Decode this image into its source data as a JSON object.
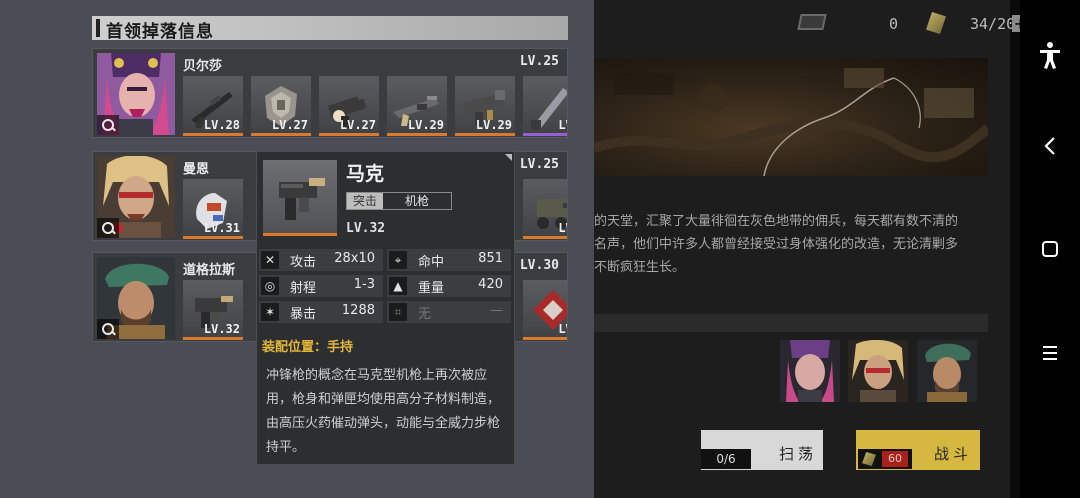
{
  "header": {
    "title": "首领掉落信息"
  },
  "bosses": [
    {
      "name": "贝尔莎",
      "level": "LV.25",
      "drops": [
        {
          "level": "LV.28",
          "icon": "sniper-rifle-icon",
          "rarity": "orange"
        },
        {
          "level": "LV.27",
          "icon": "armor-part-icon",
          "rarity": "orange"
        },
        {
          "level": "LV.27",
          "icon": "heavy-gun-icon",
          "rarity": "orange"
        },
        {
          "level": "LV.29",
          "icon": "rifle-icon",
          "rarity": "orange"
        },
        {
          "level": "LV.29",
          "icon": "launcher-icon",
          "rarity": "orange"
        },
        {
          "level": "LV.",
          "icon": "blade-icon",
          "rarity": "purple"
        }
      ]
    },
    {
      "name": "曼恩",
      "level": "LV.25",
      "drops": [
        {
          "level": "LV.31",
          "icon": "gauntlet-icon",
          "rarity": "orange"
        },
        {
          "level": "LV.",
          "icon": "turret-icon",
          "rarity": "orange"
        }
      ]
    },
    {
      "name": "道格拉斯",
      "level": "LV.30",
      "drops": [
        {
          "level": "LV.32",
          "icon": "machine-pistol-icon",
          "rarity": "orange"
        },
        {
          "level": "LV.",
          "icon": "spiked-armor-icon",
          "rarity": "orange"
        }
      ]
    }
  ],
  "tooltip": {
    "name": "马克",
    "tag_type": "突击",
    "tag_class": "机枪",
    "level": "LV.32",
    "stats": [
      {
        "icon": "crossed-swords-icon",
        "glyph": "✕",
        "label": "攻击",
        "value": "28x10"
      },
      {
        "icon": "target-icon",
        "glyph": "⌖",
        "label": "命中",
        "value": "851"
      },
      {
        "icon": "range-icon",
        "glyph": "◎",
        "label": "射程",
        "value": "1-3"
      },
      {
        "icon": "weight-icon",
        "glyph": "▲",
        "label": "重量",
        "value": "420"
      },
      {
        "icon": "crit-icon",
        "glyph": "✶",
        "label": "暴击",
        "value": "1288"
      },
      {
        "icon": "none-icon",
        "glyph": "⌗",
        "label": "无",
        "value": "—"
      }
    ],
    "slot": "装配位置：手持",
    "description": "冲锋枪的概念在马克型机枪上再次被应用，枪身和弹匣均使用高分子材料制造，由高压火药催动弹头，动能与全威力步枪持平。"
  },
  "topbar": {
    "ticket_count": "0",
    "stamina": "34/200",
    "plus": "+"
  },
  "stage_description": [
    "的天堂，汇聚了大量徘徊在灰色地带的佣兵，每天都有数不清的",
    "名声，他们中许多人都曾经接受过身体强化的改造，无论清剿多",
    "不断疯狂生长。"
  ],
  "actions": {
    "sweep_count": "0/6",
    "sweep_label": "扫荡",
    "fight_cost": "60",
    "fight_label": "战斗"
  },
  "colors": {
    "rarity_orange": "#d97a2c",
    "rarity_purple": "#9660d0",
    "slot_text": "#e3b73a",
    "fight_button": "#d6b840"
  }
}
